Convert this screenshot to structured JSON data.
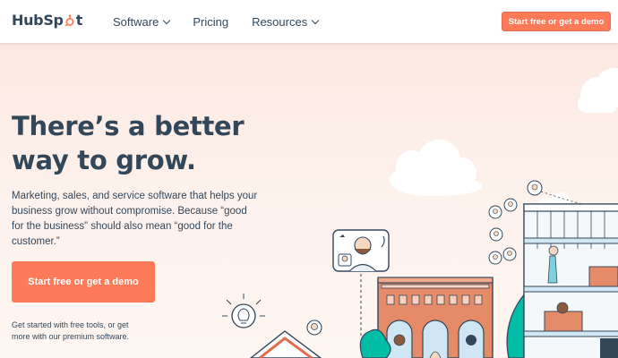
{
  "brand": {
    "logo_text_before": "HubSp",
    "logo_text_after": "t"
  },
  "nav": {
    "items": [
      {
        "label": "Software",
        "has_dropdown": true
      },
      {
        "label": "Pricing",
        "has_dropdown": false
      },
      {
        "label": "Resources",
        "has_dropdown": true
      }
    ],
    "cta_label": "Start free or get a demo"
  },
  "hero": {
    "headline_line1": "There’s a better",
    "headline_line2": "way to grow.",
    "subcopy": "Marketing, sales, and service software that helps your business grow without compromise. Because “good for the business” should also mean “good for the customer.”",
    "cta_label": "Start free or get a demo",
    "note": "Get started with free tools, or get more with our premium software."
  },
  "colors": {
    "accent": "#ff7a59",
    "text": "#33475b",
    "hero_bg": "#fbe9e1"
  },
  "icons": [
    "hubspot-sprocket-icon",
    "chevron-down-icon",
    "lightbulb-icon",
    "video-call-icon"
  ]
}
